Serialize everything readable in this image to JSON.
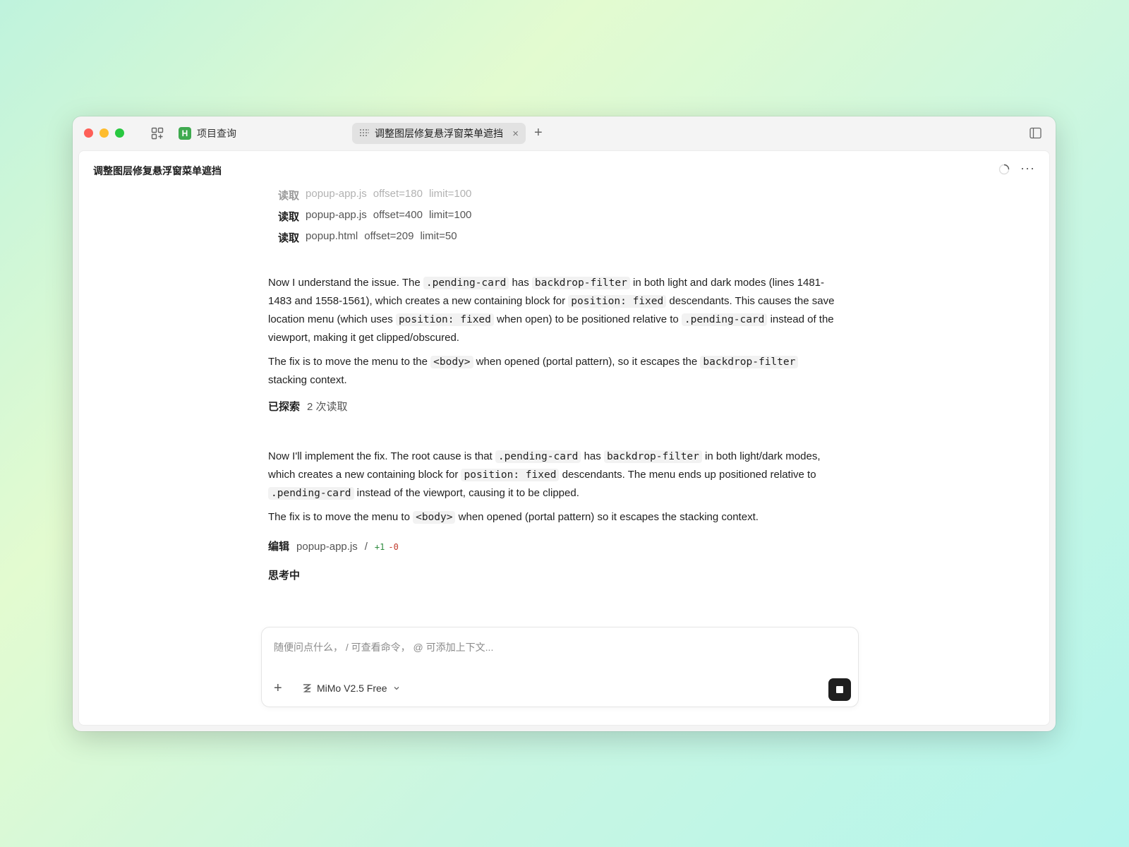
{
  "tabs": {
    "project": {
      "badge": "H",
      "label": "项目查询"
    },
    "active": {
      "label": "调整图层修复悬浮窗菜单遮挡",
      "close": "×"
    },
    "add": "+"
  },
  "page": {
    "title": "调整图层修复悬浮窗菜单遮挡",
    "more": "···"
  },
  "tool_calls": [
    {
      "verb": "读取",
      "file": "popup-app.js",
      "offset": "offset=180",
      "limit": "limit=100"
    },
    {
      "verb": "读取",
      "file": "popup-app.js",
      "offset": "offset=400",
      "limit": "limit=100"
    },
    {
      "verb": "读取",
      "file": "popup.html",
      "offset": "offset=209",
      "limit": "limit=50"
    }
  ],
  "msg1": {
    "t1": "Now I understand the issue. The ",
    "c1": ".pending-card",
    "t2": " has ",
    "c2": "backdrop-filter",
    "t3": " in both light and dark modes (lines 1481-1483 and 1558-1561), which creates a new containing block for ",
    "c3": "position: fixed",
    "t4": " descendants. This causes the save location menu (which uses ",
    "c4": "position: fixed",
    "t5": " when open) to be positioned relative to ",
    "c5": ".pending-card",
    "t6": " instead of the viewport, making it get clipped/obscured."
  },
  "msg2": {
    "t1": "The fix is to move the menu to the ",
    "c1": "<body>",
    "t2": " when opened (portal pattern), so it escapes the ",
    "c2": "backdrop-filter",
    "t3": " stacking context."
  },
  "explored": {
    "verb": "已探索",
    "detail": "2 次读取"
  },
  "msg3": {
    "t1": "Now I'll implement the fix. The root cause is that ",
    "c1": ".pending-card",
    "t2": " has ",
    "c2": "backdrop-filter",
    "t3": " in both light/dark modes, which creates a new containing block for ",
    "c3": "position: fixed",
    "t4": " descendants. The menu ends up positioned relative to ",
    "c4": ".pending-card",
    "t5": " instead of the viewport, causing it to be clipped."
  },
  "msg4": {
    "t1": "The fix is to move the menu to ",
    "c1": "<body>",
    "t2": " when opened (portal pattern) so it escapes the stacking context."
  },
  "edit": {
    "verb": "编辑",
    "file": "popup-app.js",
    "sep": "/",
    "added": "+1",
    "removed": "-0"
  },
  "thinking": "思考中",
  "composer": {
    "placeholder": "随便问点什么， / 可查看命令， @ 可添加上下文...",
    "plus": "+",
    "model": "MiMo V2.5 Free"
  }
}
